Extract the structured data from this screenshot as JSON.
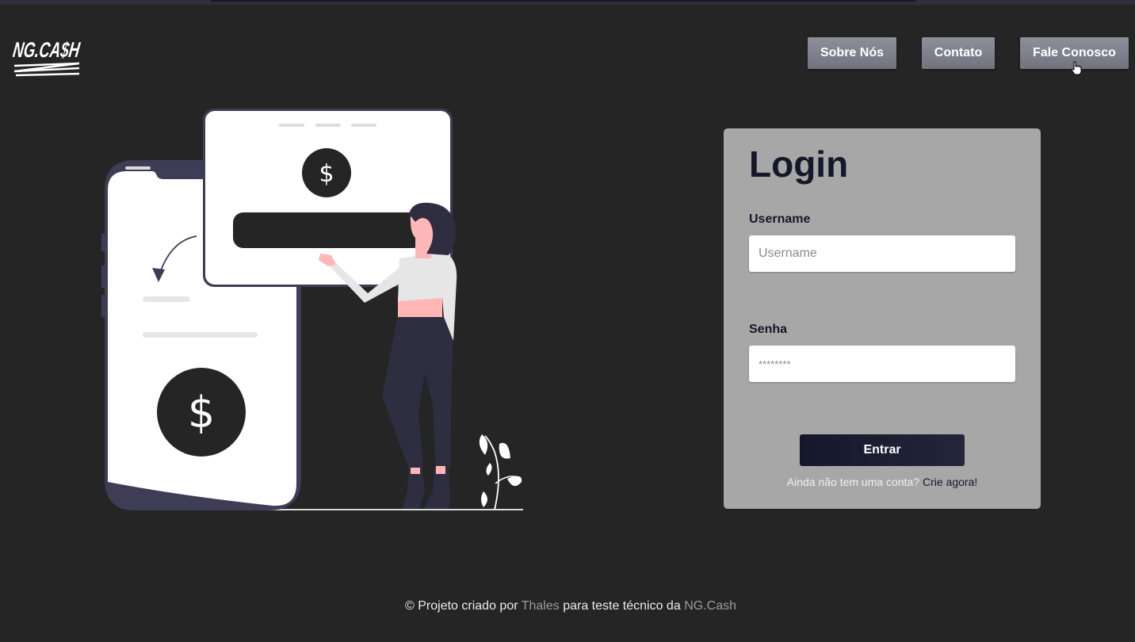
{
  "brand": {
    "logo_text": "NG.CA$H"
  },
  "nav": {
    "about_label": "Sobre Nós",
    "contact_label": "Contato",
    "talk_label": "Fale Conosco"
  },
  "illustration": {
    "currency_symbol": "$"
  },
  "login": {
    "title": "Login",
    "username_label": "Username",
    "username_placeholder": "Username",
    "username_value": "",
    "password_label": "Senha",
    "password_placeholder": "********",
    "password_value": "",
    "submit_label": "Entrar",
    "signup_prompt": "Ainda não tem uma conta?",
    "signup_link": "Crie agora!"
  },
  "footer": {
    "prefix": "© Projeto criado por",
    "author_link": "Thales",
    "middle": "para teste técnico da",
    "company_link": "NG.Cash"
  },
  "colors": {
    "background": "#252525",
    "card": "#a7a7a7",
    "accent_dark": "#15172a",
    "nav_button": "#7f818c",
    "illustration_purple": "#3f3d56",
    "skin_pink": "#ffb6b6"
  }
}
